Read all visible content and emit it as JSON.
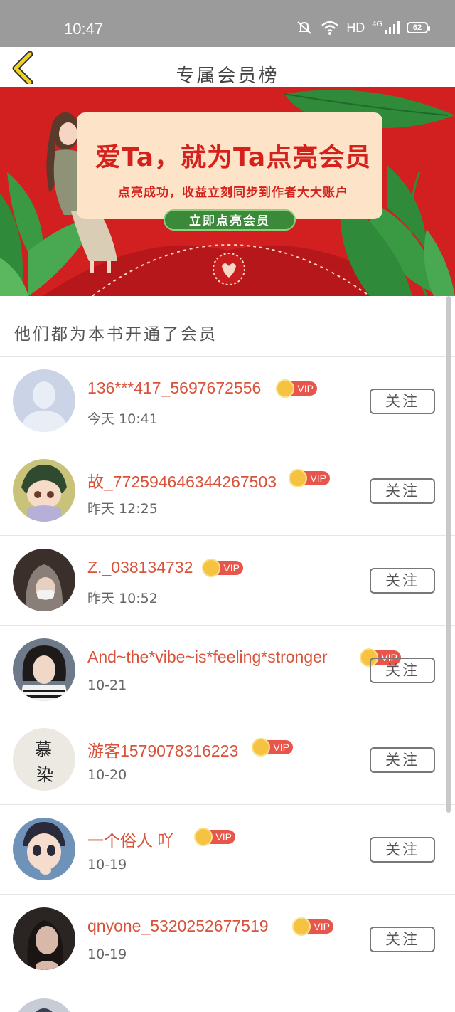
{
  "status_bar": {
    "time": "10:47",
    "network": "HD",
    "signal": "4G",
    "battery": "62"
  },
  "nav": {
    "title": "专属会员榜"
  },
  "banner": {
    "headline": "爱Ta，就为Ta点亮会员",
    "subtitle": "点亮成功，收益立刻同步到作者大大账户",
    "button": "立即点亮会员"
  },
  "section": {
    "title": "他们都为本书开通了会员"
  },
  "vip_label": "VIP",
  "follow_label": "关注",
  "members": [
    {
      "name": "136***417_5697672556",
      "time": "今天 10:41"
    },
    {
      "name": "故_772594646344267503",
      "time": "昨天 12:25"
    },
    {
      "name": "Z._038134732",
      "time": "昨天 10:52"
    },
    {
      "name": "And~the*vibe~is*feeling*stronger",
      "time": "10-21"
    },
    {
      "name": "游客1579078316223",
      "time": "10-20",
      "avatar_text_1": "慕",
      "avatar_text_2": "染"
    },
    {
      "name": "一个俗人 吖",
      "time": "10-19"
    },
    {
      "name": "qnyone_5320252677519",
      "time": "10-19"
    }
  ]
}
